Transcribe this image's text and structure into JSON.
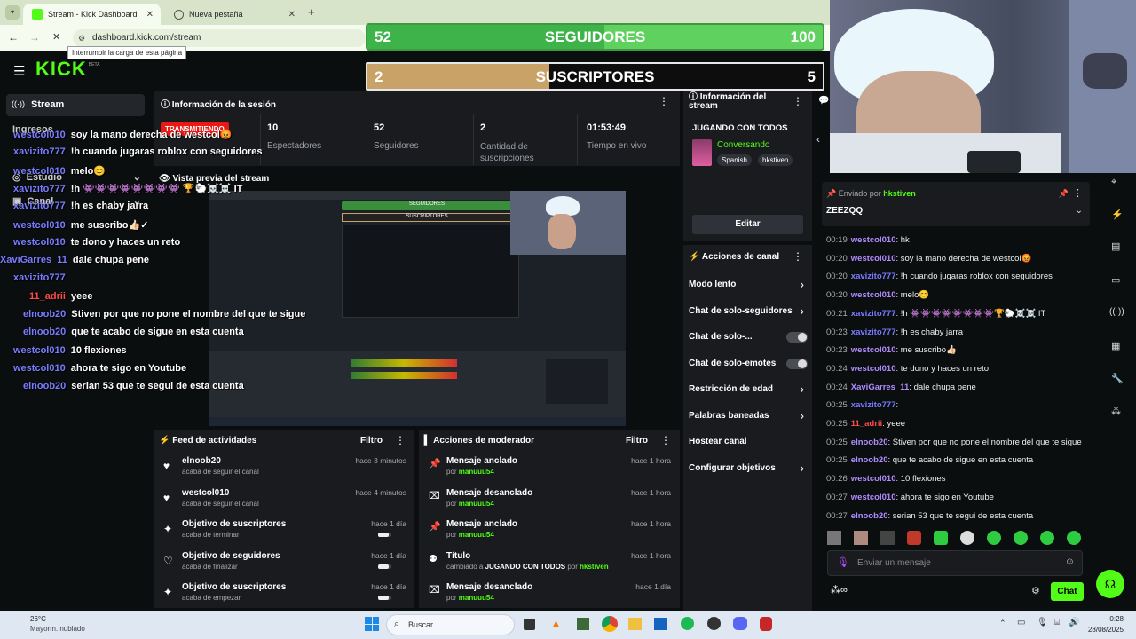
{
  "browser": {
    "tabs": [
      {
        "title": "Stream - Kick Dashboard",
        "active": true
      },
      {
        "title": "Nueva pestaña",
        "active": false
      }
    ],
    "url": "dashboard.kick.com/stream",
    "tooltip": "Interrumpir la carga de esta página"
  },
  "overlay": {
    "followers": {
      "label": "SEGUIDORES",
      "current": "52",
      "goal": "100",
      "progress": 0.52
    },
    "subs": {
      "label": "SUSCRIPTORES",
      "current": "2",
      "goal": "5",
      "progress": 0.4
    }
  },
  "sidebar": {
    "logo": "KICK",
    "beta": "BETA",
    "items": [
      "Stream",
      "Ingresos",
      "Estudio",
      "Canal"
    ]
  },
  "session": {
    "title": "Información de la sesión",
    "badge": "TRANSMITIENDO",
    "stats": [
      {
        "value": "10",
        "label": "Espectadores"
      },
      {
        "value": "52",
        "label": "Seguidores"
      },
      {
        "value": "2",
        "label": "Cantidad de suscripciones"
      },
      {
        "value": "01:53:49",
        "label": "Tiempo en vivo"
      }
    ]
  },
  "preview": {
    "title": "Vista previa del stream"
  },
  "stream_info": {
    "title": "Información del stream",
    "stream_title": "JUGANDO CON TODOS",
    "category": "Conversando",
    "tags": [
      "Spanish",
      "hkstiven"
    ],
    "edit": "Editar"
  },
  "channel_actions": {
    "title": "Acciones de canal",
    "items": [
      {
        "label": "Modo lento",
        "kind": "chevron"
      },
      {
        "label": "Chat de solo-seguidores",
        "kind": "chevron"
      },
      {
        "label": "Chat de solo-...",
        "kind": "toggle"
      },
      {
        "label": "Chat de solo-emotes",
        "kind": "toggle"
      },
      {
        "label": "Restricción de edad",
        "kind": "chevron"
      },
      {
        "label": "Palabras baneadas",
        "kind": "chevron"
      },
      {
        "label": "Hostear canal",
        "kind": "none"
      },
      {
        "label": "Configurar objetivos",
        "kind": "chevron"
      }
    ]
  },
  "activity": {
    "title": "Feed de actividades",
    "filter": "Filtro",
    "items": [
      {
        "icon": "heart",
        "name": "elnoob20",
        "sub": "acaba de seguir el canal",
        "time": "hace 3 minutos",
        "bar": false
      },
      {
        "icon": "heart",
        "name": "westcol010",
        "sub": "acaba de seguir el canal",
        "time": "hace 4 minutos",
        "bar": false
      },
      {
        "icon": "sparkle",
        "name": "Objetivo de suscriptores",
        "sub": "acaba de terminar",
        "time": "hace 1 día",
        "bar": true
      },
      {
        "icon": "heart-outline",
        "name": "Objetivo de seguidores",
        "sub": "acaba de finalizar",
        "time": "hace 1 día",
        "bar": true
      },
      {
        "icon": "sparkle",
        "name": "Objetivo de suscriptores",
        "sub": "acaba de empezar",
        "time": "hace 1 día",
        "bar": true
      }
    ]
  },
  "modactions": {
    "title": "Acciones de moderador",
    "filter": "Filtro",
    "items": [
      {
        "icon": "pin",
        "name": "Mensaje anclado",
        "pre": "por ",
        "who": "manuuu54",
        "post": "",
        "time": "hace 1 hora"
      },
      {
        "icon": "unpin",
        "name": "Mensaje desanclado",
        "pre": "por ",
        "who": "manuuu54",
        "post": "",
        "time": "hace 1 hora"
      },
      {
        "icon": "pin",
        "name": "Mensaje anclado",
        "pre": "por ",
        "who": "manuuu54",
        "post": "",
        "time": "hace 1 hora"
      },
      {
        "icon": "people",
        "name": "Título",
        "pre": "cambiado a ",
        "who": "hkstiven",
        "post": "JUGANDO CON TODOS",
        "time": "hace 1 hora"
      },
      {
        "icon": "unpin",
        "name": "Mensaje desanclado",
        "pre": "por ",
        "who": "manuuu54",
        "post": "",
        "time": "hace 1 día"
      }
    ]
  },
  "overlay_chat": [
    {
      "user": "westcol010",
      "msg": "soy la mano derecha de westcol😡"
    },
    {
      "user": "xavizito777",
      "msg": "!h cuando jugaras roblox con seguidores"
    },
    {
      "user": "westcol010",
      "msg": "melo😊"
    },
    {
      "user": "xavizito777",
      "msg": "!h 👾👾👾👾👾👾👾👾 🏆🐑☠️☠️ IT"
    },
    {
      "user": "xavizito777",
      "msg": "!h es chaby jarra"
    },
    {
      "user": "westcol010",
      "msg": "me suscribo👍🏻✓"
    },
    {
      "user": "westcol010",
      "msg": "te dono y haces un reto"
    },
    {
      "user": "XaviGarres_11",
      "msg": "dale chupa pene"
    },
    {
      "user": "xavizito777",
      "msg": ""
    },
    {
      "user": "11_adrii",
      "msg": "yeee"
    },
    {
      "user": "elnoob20",
      "msg": "Stiven por que no pone el nombre del que te sigue"
    },
    {
      "user": "elnoob20",
      "msg": "que te acabo de sigue en esta cuenta"
    },
    {
      "user": "westcol010",
      "msg": "10 flexiones"
    },
    {
      "user": "westcol010",
      "msg": "ahora te sigo en Youtube"
    },
    {
      "user": "elnoob20",
      "msg": "serian 53 que te segui de esta cuenta"
    }
  ],
  "chat": {
    "pinned_by_label": "Enviado por",
    "pinned_by": "hkstiven",
    "pinned_msg": "ZEEZQQ",
    "messages": [
      {
        "time": "00:19",
        "user": "westcol010",
        "msg": ": hk",
        "color": "#b08cff"
      },
      {
        "time": "00:20",
        "user": "westcol010",
        "msg": ": soy la mano derecha de westcol😡",
        "color": "#b08cff"
      },
      {
        "time": "00:20",
        "user": "xavizito777",
        "msg": ": !h cuando jugaras roblox con seguidores",
        "color": "#7a7cff"
      },
      {
        "time": "00:20",
        "user": "westcol010",
        "msg": ": melo😊",
        "color": "#b08cff"
      },
      {
        "time": "00:21",
        "user": "xavizito777",
        "msg": ": !h 👾👾👾👾👾👾👾👾🏆🐑☠️☠️ IT",
        "color": "#7a7cff"
      },
      {
        "time": "00:23",
        "user": "xavizito777",
        "msg": ": !h es chaby jarra",
        "color": "#7a7cff"
      },
      {
        "time": "00:23",
        "user": "westcol010",
        "msg": ": me suscribo👍🏻",
        "color": "#b08cff"
      },
      {
        "time": "00:24",
        "user": "westcol010",
        "msg": ": te dono y haces un reto",
        "color": "#b08cff"
      },
      {
        "time": "00:24",
        "user": "XaviGarres_11",
        "msg": ": dale chupa pene",
        "color": "#b08cff"
      },
      {
        "time": "00:25",
        "user": "xavizito777",
        "msg": ":",
        "color": "#7a7cff"
      },
      {
        "time": "00:25",
        "user": "11_adrii",
        "msg": ": yeee",
        "color": "#ff4a4a"
      },
      {
        "time": "00:25",
        "user": "elnoob20",
        "msg": ": Stiven por que no pone el nombre del que te sigue",
        "color": "#b08cff"
      },
      {
        "time": "00:25",
        "user": "elnoob20",
        "msg": ": que te acabo de sigue en esta cuenta",
        "color": "#b08cff"
      },
      {
        "time": "00:26",
        "user": "westcol010",
        "msg": ": 10 flexiones",
        "color": "#b08cff"
      },
      {
        "time": "00:27",
        "user": "westcol010",
        "msg": ": ahora te sigo en Youtube",
        "color": "#b08cff"
      },
      {
        "time": "00:27",
        "user": "elnoob20",
        "msg": ": serian 53 que te segui de esta cuenta",
        "color": "#b08cff"
      }
    ],
    "input_placeholder": "Enviar un mensaje",
    "send": "Chat"
  },
  "taskbar": {
    "temp": "26°C",
    "weather": "Mayorm. nublado",
    "search": "Buscar",
    "time": "0:28",
    "date": "28/08/2025"
  },
  "colors": {
    "accent": "#53fc18",
    "bg": "#0b0e0f",
    "panel": "#191b1f"
  }
}
